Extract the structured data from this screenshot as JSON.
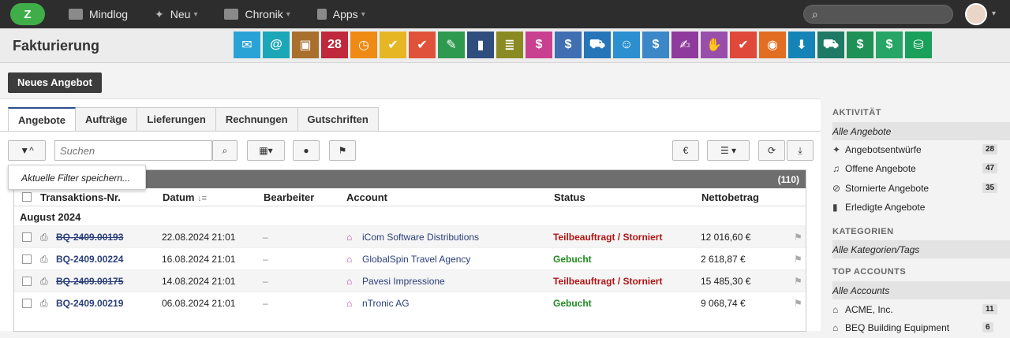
{
  "topbar": {
    "logo": "Z",
    "nav": [
      {
        "label": "Mindlog",
        "icon": "chat-icon"
      },
      {
        "label": "Neu",
        "icon": "sparkle-icon"
      },
      {
        "label": "Chronik",
        "icon": "monitor-icon"
      },
      {
        "label": "Apps",
        "icon": "tablet-icon"
      }
    ]
  },
  "module": {
    "title": "Fakturierung",
    "apps": [
      {
        "icon": "mail-icon",
        "color": "#29a3d6",
        "glyph": "✉"
      },
      {
        "icon": "contact-card-icon",
        "color": "#1ba7b8",
        "glyph": "@"
      },
      {
        "icon": "address-book-icon",
        "color": "#a86f2d",
        "glyph": "▣"
      },
      {
        "icon": "calendar-icon",
        "color": "#c0283b",
        "glyph": "28"
      },
      {
        "icon": "stopwatch-icon",
        "color": "#ef8a14",
        "glyph": "◷"
      },
      {
        "icon": "tasks-icon",
        "color": "#e6b625",
        "glyph": "✔"
      },
      {
        "icon": "folder-check-icon",
        "color": "#e0533a",
        "glyph": "✔"
      },
      {
        "icon": "notes-icon",
        "color": "#2e9a4f",
        "glyph": "✎"
      },
      {
        "icon": "bookmark-icon",
        "color": "#2f4e7e",
        "glyph": "▮"
      },
      {
        "icon": "document-icon",
        "color": "#8a8a23",
        "glyph": "≣"
      },
      {
        "icon": "cashier-icon",
        "color": "#c8408f",
        "glyph": "$"
      },
      {
        "icon": "dollar-icon",
        "color": "#3f6fb2",
        "glyph": "$"
      },
      {
        "icon": "truck-icon",
        "color": "#2675b9",
        "glyph": "⛟"
      },
      {
        "icon": "support-icon",
        "color": "#2b8fd0",
        "glyph": "☺"
      },
      {
        "icon": "money-bag-icon",
        "color": "#3b87c8",
        "glyph": "$"
      },
      {
        "icon": "contract-icon",
        "color": "#8f3b9d",
        "glyph": "✍"
      },
      {
        "icon": "handshake-icon",
        "color": "#9a4eab",
        "glyph": "✋"
      },
      {
        "icon": "pdf-icon",
        "color": "#e0483a",
        "glyph": "✔"
      },
      {
        "icon": "broadcast-icon",
        "color": "#e26e23",
        "glyph": "◉"
      },
      {
        "icon": "download-icon",
        "color": "#1583b5",
        "glyph": "⬇"
      },
      {
        "icon": "dolly-icon",
        "color": "#1e7a64",
        "glyph": "⛟"
      },
      {
        "icon": "cash-stack-icon",
        "color": "#1f9156",
        "glyph": "$"
      },
      {
        "icon": "price-tag-icon",
        "color": "#27a566",
        "glyph": "$"
      },
      {
        "icon": "database-icon",
        "color": "#19a05a",
        "glyph": "⛁"
      }
    ]
  },
  "actions": {
    "new_offer": "Neues Angebot"
  },
  "tabs": [
    "Angebote",
    "Aufträge",
    "Lieferungen",
    "Rechnungen",
    "Gutschriften"
  ],
  "toolbar": {
    "search_placeholder": "Suchen",
    "currency": "€"
  },
  "filter_menu": {
    "save_filter": "Aktuelle Filter speichern..."
  },
  "grid": {
    "count": "(110)",
    "columns": {
      "txn": "Transaktions-Nr.",
      "date": "Datum",
      "editor": "Bearbeiter",
      "account": "Account",
      "status": "Status",
      "net": "Nettobetrag"
    },
    "group": "August 2024",
    "rows": [
      {
        "txn": "BQ-2409.00193",
        "date": "22.08.2024 21:01",
        "editor": "–",
        "account": "iCom Software Distributions",
        "status": "Teilbeauftragt / Storniert",
        "net": "12 016,60 €"
      },
      {
        "txn": "BQ-2409.00224",
        "date": "16.08.2024 21:01",
        "editor": "–",
        "account": "GlobalSpin Travel Agency",
        "status": "Gebucht",
        "net": "2 618,87 €"
      },
      {
        "txn": "BQ-2409.00175",
        "date": "14.08.2024 21:01",
        "editor": "–",
        "account": "Pavesi Impressione",
        "status": "Teilbeauftragt / Storniert",
        "net": "15 485,30 €"
      },
      {
        "txn": "BQ-2409.00219",
        "date": "06.08.2024 21:01",
        "editor": "–",
        "account": "nTronic AG",
        "status": "Gebucht",
        "net": "9 068,74 €"
      }
    ]
  },
  "sidebar": {
    "activity_heading": "AKTIVITÄT",
    "activity_all": "Alle Angebote",
    "activity_items": [
      {
        "label": "Angebotsentwürfe",
        "count": "28",
        "icon": "sparkle-icon"
      },
      {
        "label": "Offene Angebote",
        "count": "47",
        "icon": "bell-icon"
      },
      {
        "label": "Stornierte Angebote",
        "count": "35",
        "icon": "ban-icon"
      },
      {
        "label": "Erledigte Angebote",
        "count": "",
        "icon": "door-icon"
      }
    ],
    "categories_heading": "KATEGORIEN",
    "categories_all": "Alle Kategorien/Tags",
    "top_accounts_heading": "TOP ACCOUNTS",
    "top_accounts_all": "Alle Accounts",
    "top_accounts": [
      {
        "label": "ACME, Inc.",
        "count": "11"
      },
      {
        "label": "BEQ Building Equipment",
        "count": "6"
      }
    ]
  }
}
